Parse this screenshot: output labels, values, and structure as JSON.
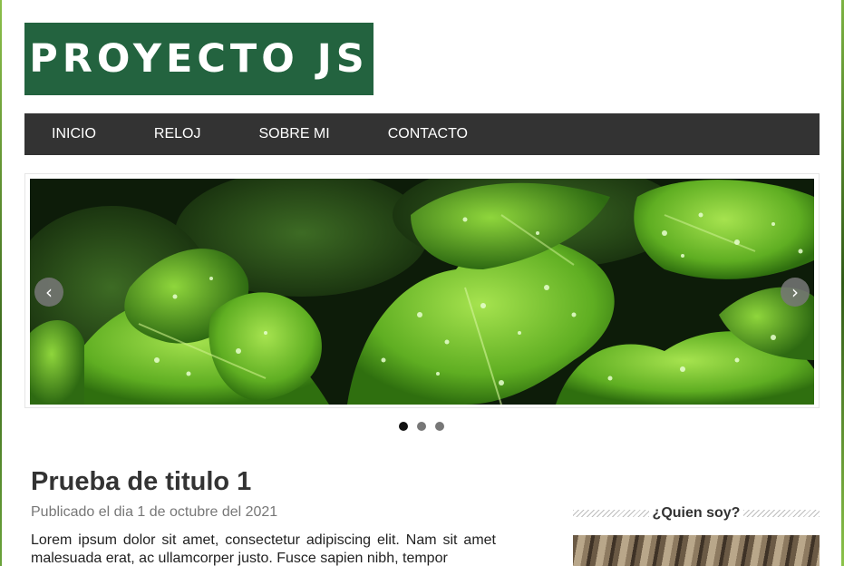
{
  "site": {
    "logo_text": "PROYECTO JS"
  },
  "nav": {
    "items": [
      {
        "label": "INICIO"
      },
      {
        "label": "RELOJ"
      },
      {
        "label": "SOBRE MI"
      },
      {
        "label": "CONTACTO"
      }
    ]
  },
  "slider": {
    "prev_icon": "chevron-left-icon",
    "next_icon": "chevron-right-icon",
    "prev_glyph": "‹",
    "next_glyph": "›",
    "slide_count": 3,
    "active_slide": 1
  },
  "post": {
    "title": "Prueba de titulo 1",
    "meta": "Publicado el dia 1 de octubre del 2021",
    "body": "Lorem ipsum dolor sit amet, consectetur adipiscing elit. Nam sit amet malesuada erat, ac ullamcorper justo. Fusce sapien nibh, tempor"
  },
  "sidebar": {
    "widget_title": "¿Quien soy?"
  },
  "colors": {
    "logo_bg": "#23633f",
    "nav_bg": "#333333",
    "active_dot": "#111111",
    "inactive_dot": "#777777"
  }
}
